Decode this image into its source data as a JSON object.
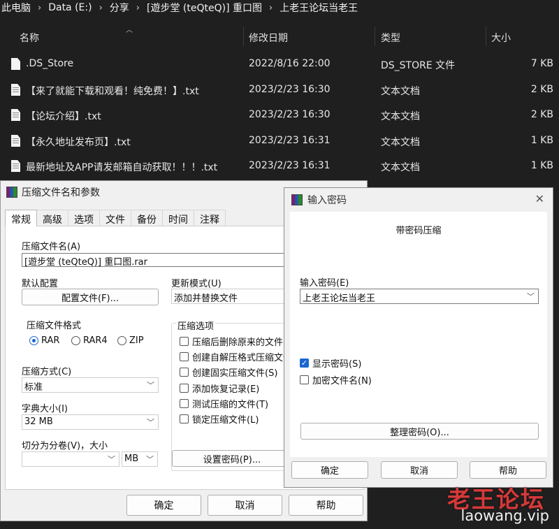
{
  "breadcrumb": [
    "此电脑",
    "Data (E:)",
    "分享",
    "[遊步堂 (teQteQ)] 重口图",
    "上老王论坛当老王"
  ],
  "columns": {
    "name": "名称",
    "date": "修改日期",
    "type": "类型",
    "size": "大小"
  },
  "files": [
    {
      "name": ".DS_Store",
      "date": "2022/8/16 22:00",
      "type": "DS_STORE 文件",
      "size": "7 KB"
    },
    {
      "name": "【来了就能下载和观看！纯免费！】.txt",
      "date": "2023/2/23 16:30",
      "type": "文本文档",
      "size": "2 KB"
    },
    {
      "name": "【论坛介绍】.txt",
      "date": "2023/2/23 16:30",
      "type": "文本文档",
      "size": "2 KB"
    },
    {
      "name": "【永久地址发布页】.txt",
      "date": "2023/2/23 16:31",
      "type": "文本文档",
      "size": "1 KB"
    },
    {
      "name": "最新地址及APP请发邮箱自动获取！！！.txt",
      "date": "2023/2/23 16:31",
      "type": "文本文档",
      "size": "1 KB"
    }
  ],
  "rar": {
    "title": "压缩文件名和参数",
    "tabs": [
      "常规",
      "高级",
      "选项",
      "文件",
      "备份",
      "时间",
      "注释"
    ],
    "archive_label": "压缩文件名(A)",
    "archive_value": "[遊步堂 (teQteQ)] 重口图.rar",
    "profile_label": "默认配置",
    "profile_button": "配置文件(F)...",
    "update_label": "更新模式(U)",
    "update_value": "添加并替换文件",
    "format_label": "压缩文件格式",
    "formats": [
      "RAR",
      "RAR4",
      "ZIP"
    ],
    "options_label": "压缩选项",
    "options": [
      "压缩后删除原来的文件(D",
      "创建自解压格式压缩文件",
      "创建固实压缩文件(S)",
      "添加恢复记录(E)",
      "测试压缩的文件(T)",
      "锁定压缩文件(L)"
    ],
    "method_label": "压缩方式(C)",
    "method_value": "标准",
    "dict_label": "字典大小(I)",
    "dict_value": "32 MB",
    "split_label": "切分为分卷(V)，大小",
    "split_unit": "MB",
    "setpwd_button": "设置密码(P)...",
    "ok": "确定",
    "cancel": "取消",
    "help": "帮助"
  },
  "pwd": {
    "title": "输入密码",
    "heading": "带密码压缩",
    "enter_label": "输入密码(E)",
    "password_value": "上老王论坛当老王",
    "show_password": "显示密码(S)",
    "encrypt_names": "加密文件名(N)",
    "organize_button": "整理密码(O)...",
    "ok": "确定",
    "cancel": "取消",
    "help": "帮助"
  },
  "watermark": {
    "cn": "老王论坛",
    "url": "laowang.vip"
  }
}
